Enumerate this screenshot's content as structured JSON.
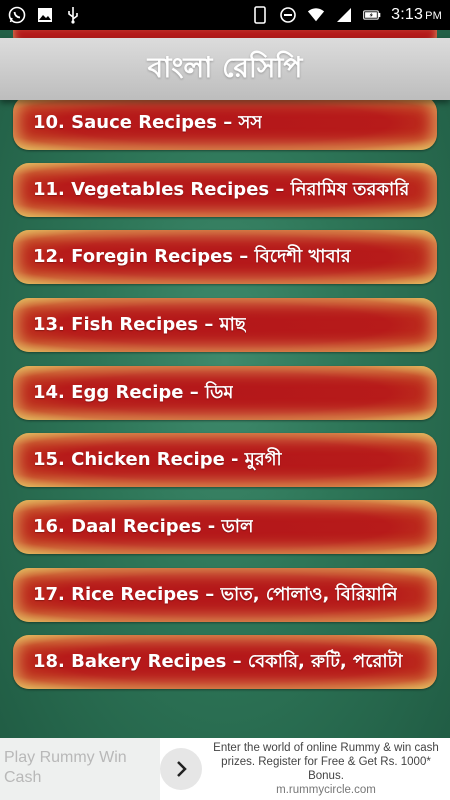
{
  "status_bar": {
    "time": "3:13",
    "ampm": "PM",
    "left_icons": [
      "whatsapp-icon",
      "image-icon",
      "usb-icon"
    ],
    "right_icons": [
      "phone-icon",
      "do-not-disturb-icon",
      "wifi-icon",
      "signal-icon",
      "battery-icon"
    ]
  },
  "header": {
    "title": "বাংলা রেসিপি"
  },
  "recipes": [
    {
      "label": "10. Sauce Recipes – সস"
    },
    {
      "label": "11. Vegetables Recipes – নিরামিষ তরকারি"
    },
    {
      "label": "12. Foregin Recipes – বিদেশী খাবার"
    },
    {
      "label": "13. Fish Recipes – মাছ"
    },
    {
      "label": "14. Egg Recipe – ডিম"
    },
    {
      "label": "15. Chicken Recipe - মুরগী"
    },
    {
      "label": "16. Daal Recipes - ডাল"
    },
    {
      "label": "17. Rice Recipes – ভাত, পোলাও, বিরিয়ানি"
    },
    {
      "label": "18. Bakery Recipes – বেকারি, রুটি, পরোটা"
    }
  ],
  "ad": {
    "left_text": "Play Rummy Win Cash",
    "right_text": "Enter the world of online Rummy & win cash prizes. Register for Free & Get Rs. 1000* Bonus.",
    "url": "m.rummycircle.com"
  },
  "colors": {
    "background": "#2e7658",
    "button_red": "#b51b1b",
    "button_glow": "#d9a94a",
    "header_gray": "#c8c8c8"
  }
}
